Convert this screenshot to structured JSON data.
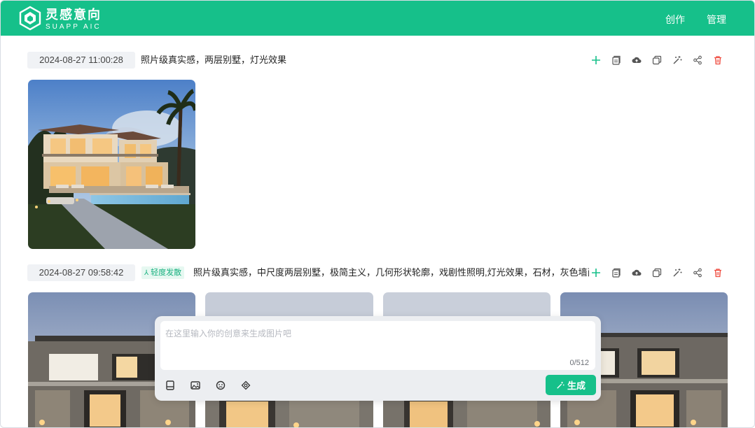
{
  "header": {
    "brand_name": "灵感意向",
    "brand_sub": "SUAPP AIC",
    "nav": [
      "创作",
      "管理"
    ]
  },
  "records": [
    {
      "time": "2024-08-27 11:00:28",
      "prompt": "照片级真实感，两层别墅，灯光效果",
      "tag": "",
      "tools": [
        "plus-icon",
        "copy-icon",
        "cloud-upload-icon",
        "duplicate-icon",
        "magic-wand-icon",
        "share-icon",
        "trash-icon"
      ]
    },
    {
      "time": "2024-08-27 09:58:42",
      "prompt": "照片级真实感，中尺度两层别墅，极简主义，几何形状轮廓，戏剧性照明,灯光效果，石材，灰色墙面",
      "tag": "轻度发散",
      "tools": [
        "plus-icon",
        "copy-icon",
        "cloud-upload-icon",
        "duplicate-icon",
        "magic-wand-icon",
        "share-icon",
        "trash-icon"
      ]
    }
  ],
  "composer": {
    "placeholder": "在这里输入你的创意来生成图片吧",
    "counter": "0/512",
    "icons": [
      "book-icon",
      "image-icon",
      "emoji-icon",
      "eye-icon"
    ],
    "generate_label": "生成"
  },
  "colors": {
    "brand": "#16c08a",
    "danger": "#ef4b3f"
  }
}
